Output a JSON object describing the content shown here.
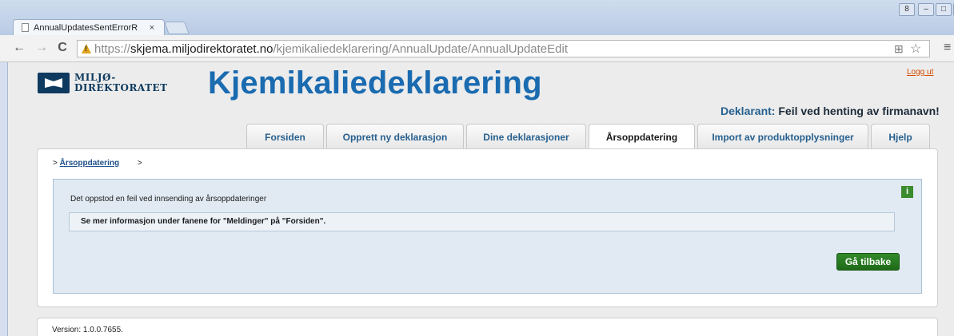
{
  "browser": {
    "tab_title": "AnnualUpdatesSentErrorR",
    "tab_close": "×",
    "back_glyph": "←",
    "forward_glyph": "→",
    "reload_glyph": "C",
    "url_scheme": "https://",
    "url_domain": "skjema.miljodirektoratet.no",
    "url_path": "/kjemikaliedeklarering/AnnualUpdate/AnnualUpdateEdit",
    "star_glyph": "☆",
    "menu_glyph": "≡",
    "translate_glyph": "⊞",
    "window_controls": {
      "user": "8",
      "minimize": "–",
      "maximize": "□",
      "close": "x"
    }
  },
  "header": {
    "logo_line1": "MILJØ-",
    "logo_line2": "DIREKTORATET",
    "app_title": "Kjemikaliedeklarering",
    "logout": "Logg ut",
    "deklarant_label": "Deklarant:",
    "deklarant_value": "Feil ved henting av firmanavn!"
  },
  "nav": {
    "tabs": [
      {
        "label": "Forsiden"
      },
      {
        "label": "Opprett ny deklarasjon"
      },
      {
        "label": "Dine deklarasjoner"
      },
      {
        "label": "Årsoppdatering",
        "active": true
      },
      {
        "label": "Import av produktopplysninger"
      },
      {
        "label": "Hjelp"
      }
    ]
  },
  "breadcrumb": {
    "prefix": ">",
    "link": "Årsoppdatering",
    "suffix": ">"
  },
  "message": {
    "info_icon": "i",
    "title": "Det oppstod en feil ved innsending av årsoppdateringer",
    "detail": "Se mer informasjon under fanene for \"Meldinger\" på \"Forsiden\".",
    "back_button": "Gå tilbake"
  },
  "footer": {
    "version": "Version: 1.0.0.7655."
  },
  "colors": {
    "accent_blue": "#1a6bb0",
    "link_blue": "#27608f",
    "button_green": "#2a7d22",
    "logout_orange": "#d24b00"
  }
}
